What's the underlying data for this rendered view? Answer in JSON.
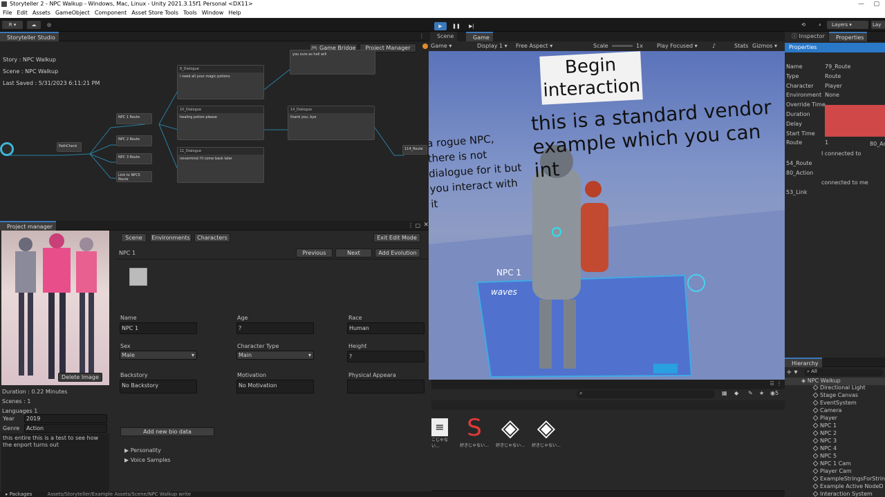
{
  "window": {
    "title": "Storyteller 2 - NPC Walkup - Windows, Mac, Linux - Unity 2021.3.15f1 Personal <DX11>"
  },
  "menu": [
    "File",
    "Edit",
    "Assets",
    "GameObject",
    "Component",
    "Asset Store Tools",
    "Tools",
    "Window",
    "Help"
  ],
  "toolbar": {
    "account": "R",
    "layers": "Layers",
    "layout": "Lay"
  },
  "storyteller": {
    "tab": "Storyteller Studio",
    "story": "Story : NPC Walkup",
    "scene": "Scene : NPC Walkup",
    "saved": "Last Saved : 5/31/2023 6:11:21 PM",
    "btn_bridge": "Game Bridge",
    "btn_pm": "Project Manager",
    "nodes": [
      {
        "header": "",
        "text": "you sure as hell will"
      },
      {
        "header": "8_Dialogue",
        "text": "i need all your magic potions"
      },
      {
        "header": "10_Dialogue",
        "text": "healing potion please"
      },
      {
        "header": "11_Dialogue",
        "text": "nevermind i'll come back later"
      },
      {
        "header": "14_Dialogue",
        "text": "thank you, bye"
      }
    ],
    "route_nodes": [
      "NPC 1 Route",
      "NPC 2 Route",
      "NPC 3 Route",
      "Link to NPC5 Route",
      "PathCheck",
      "114_Route"
    ]
  },
  "project_manager": {
    "tab": "Project manager",
    "tabs": [
      "Scene",
      "Environments",
      "Characters"
    ],
    "exit_btn": "Exit Edit Mode",
    "npc_title": "NPC 1",
    "prev_btn": "Previous",
    "next_btn": "Next",
    "evo_btn": "Add Evolution",
    "delete_btn": "Delete Image",
    "fields": {
      "name_label": "Name",
      "name_value": "NPC 1",
      "age_label": "Age",
      "age_value": "?",
      "race_label": "Race",
      "race_value": "Human",
      "sex_label": "Sex",
      "sex_value": "Male",
      "ctype_label": "Character Type",
      "ctype_value": "Main",
      "height_label": "Height",
      "height_value": "?",
      "backstory_label": "Backstory",
      "backstory_value": "No Backstory",
      "motivation_label": "Motivation",
      "motivation_value": "No Motivation",
      "appear_label": "Physical Appeara"
    },
    "bio_btn": "Add new bio data",
    "personality": "Personality",
    "voice": "Voice Samples",
    "duration": "Duration : 0.22 Minutes",
    "scenes": "Scenes : 1",
    "languages": "Languages  1",
    "year_label": "Year",
    "year_value": "2019",
    "genre_label": "Genre",
    "genre_value": "Action",
    "description": "this entire this is a test to see how the enport turns out"
  },
  "game": {
    "tab_scene": "Scene",
    "tab_game": "Game",
    "mode": "Game",
    "display": "Display 1",
    "aspect": "Free Aspect",
    "scale_label": "Scale",
    "scale_value": "1x",
    "focus": "Play Focused",
    "stats": "Stats",
    "gizmos": "Gizmos",
    "sign_begin": "Begin interaction",
    "text_vendor": "this is a standard  vendor example which you can int",
    "text_rogue": "a rogue NPC, there is not dialogue for it but you interact with it",
    "npc_label": "NPC 1",
    "waves": "waves"
  },
  "inspector": {
    "tab_inspector": "Inspector",
    "tab_properties": "Properties",
    "header": "Properties",
    "rows": [
      {
        "label": "Name",
        "value": "79_Route"
      },
      {
        "label": "Type",
        "value": "Route"
      },
      {
        "label": "Character",
        "value": "Player"
      },
      {
        "label": "Environment",
        "value": "None"
      },
      {
        "label": "Override Time",
        "value": ""
      },
      {
        "label": "Duration",
        "value": ""
      },
      {
        "label": "Delay",
        "value": ""
      },
      {
        "label": "Start Time",
        "value": ""
      },
      {
        "label": "Route",
        "value": "1"
      }
    ],
    "route_extra": "80_Ac",
    "connected_to": "I connected to",
    "list1": [
      "54_Route",
      "80_Action"
    ],
    "connected_to_me": "connected to me",
    "list2": [
      "53_Link"
    ]
  },
  "hierarchy": {
    "tab": "Hierarchy",
    "search": "All",
    "root": "NPC Walkup",
    "items": [
      "Directional Light",
      "Stage Canvas",
      "EventSystem",
      "Camera",
      "Player",
      "NPC 1",
      "NPC 2",
      "NPC 3",
      "NPC 4",
      "NPC 5",
      "NPC 1 Cam",
      "Player Cam",
      "ExampleStringsForStrin",
      "Example Active NodeD",
      "Interaction System"
    ]
  },
  "project_bar": {
    "packages": "Packages",
    "path": "Assets/Storyteller/Example Assets/Scene/NPC Walkup write",
    "count": "5"
  },
  "assets": [
    {
      "label": "こじゃない..."
    },
    {
      "label": "好きじゃない..."
    },
    {
      "label": "好きじゃない..."
    },
    {
      "label": "好きじゃない..."
    }
  ],
  "colors": {
    "accent": "#3a79bb",
    "red": "#d04848",
    "blue": "#2a78c8"
  }
}
